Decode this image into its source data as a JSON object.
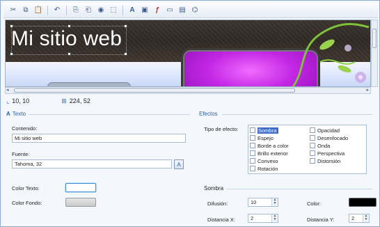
{
  "toolbar": {
    "buttons": [
      {
        "name": "cut-icon",
        "glyph": "✂"
      },
      {
        "name": "copy-icon",
        "glyph": "⧉"
      },
      {
        "name": "paste-icon",
        "glyph": "📋"
      },
      {
        "name": "undo-icon",
        "glyph": "↶"
      },
      {
        "name": "copy-format-icon",
        "glyph": "⎘"
      },
      {
        "name": "paste-format-icon",
        "glyph": "⎗"
      },
      {
        "name": "image-icon",
        "glyph": "◉"
      },
      {
        "name": "crop-icon",
        "glyph": "⬚"
      },
      {
        "name": "text-icon",
        "glyph": "A"
      },
      {
        "name": "picture-icon",
        "glyph": "▣"
      },
      {
        "name": "flash-icon",
        "glyph": "ƒ"
      },
      {
        "name": "monitor-icon",
        "glyph": "▭"
      },
      {
        "name": "document-icon",
        "glyph": "▤"
      },
      {
        "name": "binoculars-icon",
        "glyph": "⌬"
      }
    ]
  },
  "preview": {
    "title": "Mi sitio web",
    "colors": {
      "header": "#2f2823",
      "purple": "#c327e5"
    }
  },
  "status": {
    "position": "10, 10",
    "size": "224, 52"
  },
  "texto": {
    "heading": "Texto",
    "contenido_label": "Contenido:",
    "contenido_value": "Mi sitio web",
    "fuente_label": "Fuente:",
    "fuente_value": "Tahoma, 32",
    "color_texto_label": "Color Texto:",
    "color_fondo_label": "Color Fondo:",
    "color_texto": "#ffffff",
    "color_fondo": "#d0d0d0"
  },
  "efectos": {
    "heading": "Efectos",
    "tipo_label": "Tipo de efecto:",
    "left_items": [
      "Sombra",
      "Espejo",
      "Borde a color",
      "Brillo exterior",
      "Convexo",
      "Rotación"
    ],
    "right_items": [
      "Opacidad",
      "Desenfocado",
      "Onda",
      "Perspectiva",
      "Distorsión"
    ],
    "selected": "Sombra"
  },
  "sombra": {
    "heading": "Sombra",
    "difusion_label": "Difusión:",
    "difusion_value": "10",
    "color_label": "Color:",
    "color_value": "#000000",
    "distx_label": "Distancia X:",
    "distx_value": "2",
    "disty_label": "Distancia Y:",
    "disty_value": "2"
  }
}
